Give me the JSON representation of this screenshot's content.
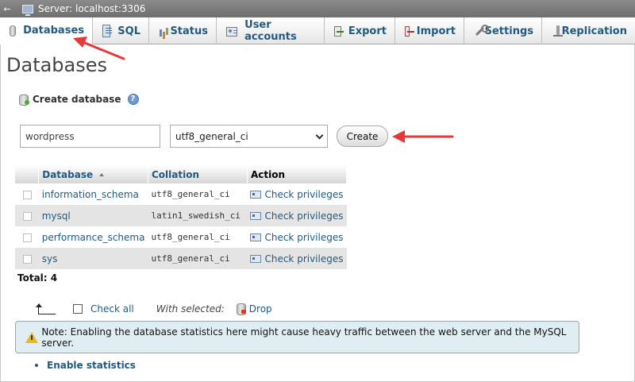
{
  "server_bar": {
    "title": "Server: localhost:3306"
  },
  "tabs": [
    {
      "label": "Databases",
      "icon": "database-icon",
      "active": true
    },
    {
      "label": "SQL",
      "icon": "sql-icon"
    },
    {
      "label": "Status",
      "icon": "status-icon"
    },
    {
      "label": "User accounts",
      "icon": "user-accounts-icon"
    },
    {
      "label": "Export",
      "icon": "export-icon"
    },
    {
      "label": "Import",
      "icon": "import-icon"
    },
    {
      "label": "Settings",
      "icon": "wrench-icon"
    },
    {
      "label": "Replication",
      "icon": "replication-icon"
    }
  ],
  "page": {
    "title": "Databases"
  },
  "create": {
    "heading": "Create database",
    "db_name_value": "wordpress",
    "collation_value": "utf8_general_ci",
    "create_label": "Create"
  },
  "table": {
    "headers": {
      "database": "Database",
      "collation": "Collation",
      "action": "Action"
    },
    "rows": [
      {
        "name": "information_schema",
        "collation": "utf8_general_ci",
        "action": "Check privileges"
      },
      {
        "name": "mysql",
        "collation": "latin1_swedish_ci",
        "action": "Check privileges"
      },
      {
        "name": "performance_schema",
        "collation": "utf8_general_ci",
        "action": "Check privileges"
      },
      {
        "name": "sys",
        "collation": "utf8_general_ci",
        "action": "Check privileges"
      }
    ],
    "total": "Total: 4"
  },
  "bulk": {
    "check_all": "Check all",
    "with_selected": "With selected:",
    "drop": "Drop"
  },
  "notice": {
    "text": "Note: Enabling the database statistics here might cause heavy traffic between the web server and the MySQL server."
  },
  "stats": {
    "label": "Enable statistics"
  },
  "colors": {
    "link": "#235a81",
    "annotation_arrow": "#e8373a",
    "notice_bg": "#e0eef3"
  }
}
